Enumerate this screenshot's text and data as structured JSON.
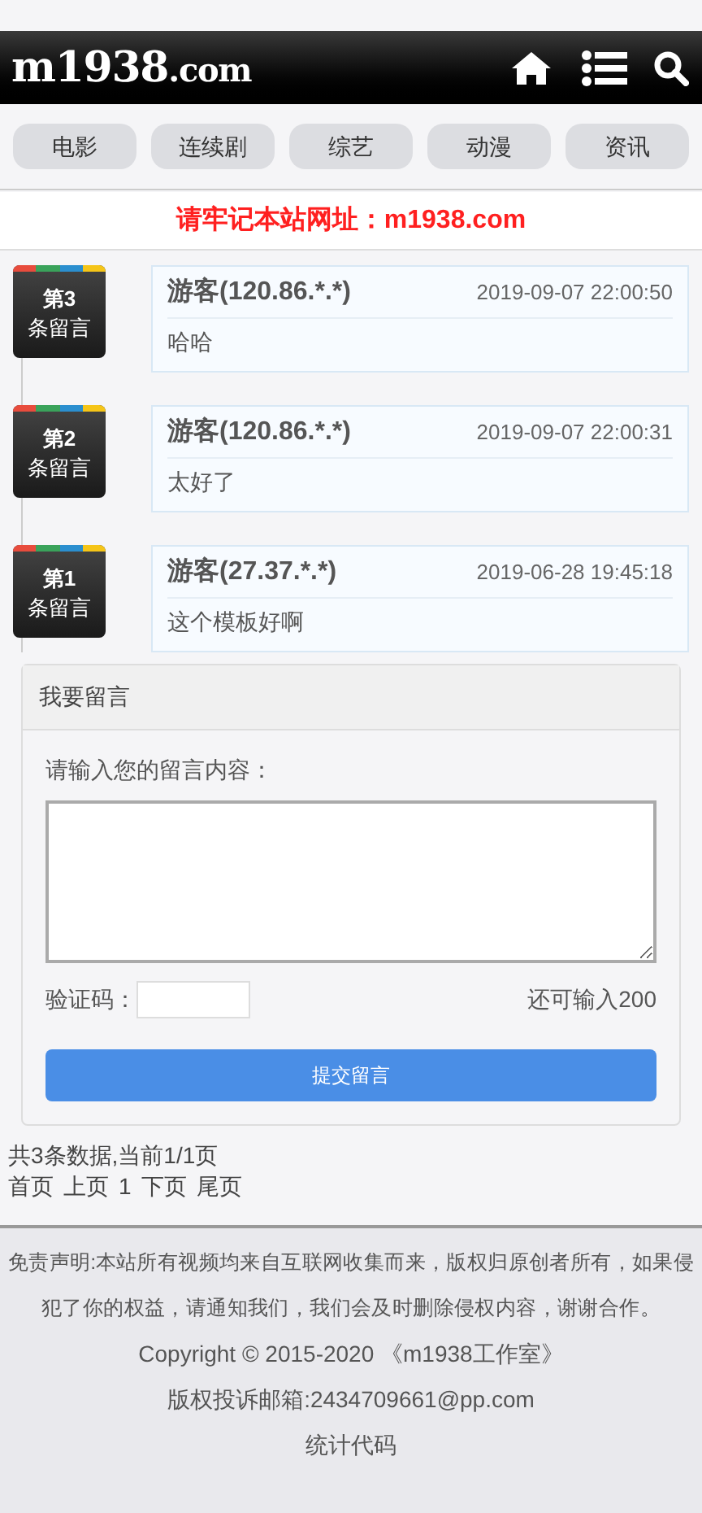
{
  "header": {
    "logo": "m1938",
    "logo_suffix": ".com"
  },
  "nav": [
    "电影",
    "连续剧",
    "综艺",
    "动漫",
    "资讯"
  ],
  "notice": "请牢记本站网址：m1938.com",
  "comments": [
    {
      "badge_top": "第3",
      "badge_bottom": "条留言",
      "author": "游客(120.86.*.*)",
      "time": "2019-09-07 22:00:50",
      "text": "哈哈"
    },
    {
      "badge_top": "第2",
      "badge_bottom": "条留言",
      "author": "游客(120.86.*.*)",
      "time": "2019-09-07 22:00:31",
      "text": "太好了"
    },
    {
      "badge_top": "第1",
      "badge_bottom": "条留言",
      "author": "游客(27.37.*.*)",
      "time": "2019-06-28 19:45:18",
      "text": "这个模板好啊"
    }
  ],
  "form": {
    "title": "我要留言",
    "content_label": "请输入您的留言内容：",
    "captcha_label": "验证码：",
    "remaining": "还可输入200",
    "submit": "提交留言"
  },
  "pagination": {
    "summary": "共3条数据,当前1/1页",
    "links": [
      "首页",
      "上页",
      "1",
      "下页",
      "尾页"
    ]
  },
  "footer": {
    "disclaimer": "免责声明:本站所有视频均来自互联网收集而来，版权归原创者所有，如果侵犯了你的权益，请通知我们，我们会及时删除侵权内容，谢谢合作。",
    "copyright": "Copyright © 2015-2020 《m1938工作室》",
    "email": "版权投诉邮箱:2434709661@pp.com",
    "stats": "统计代码"
  }
}
